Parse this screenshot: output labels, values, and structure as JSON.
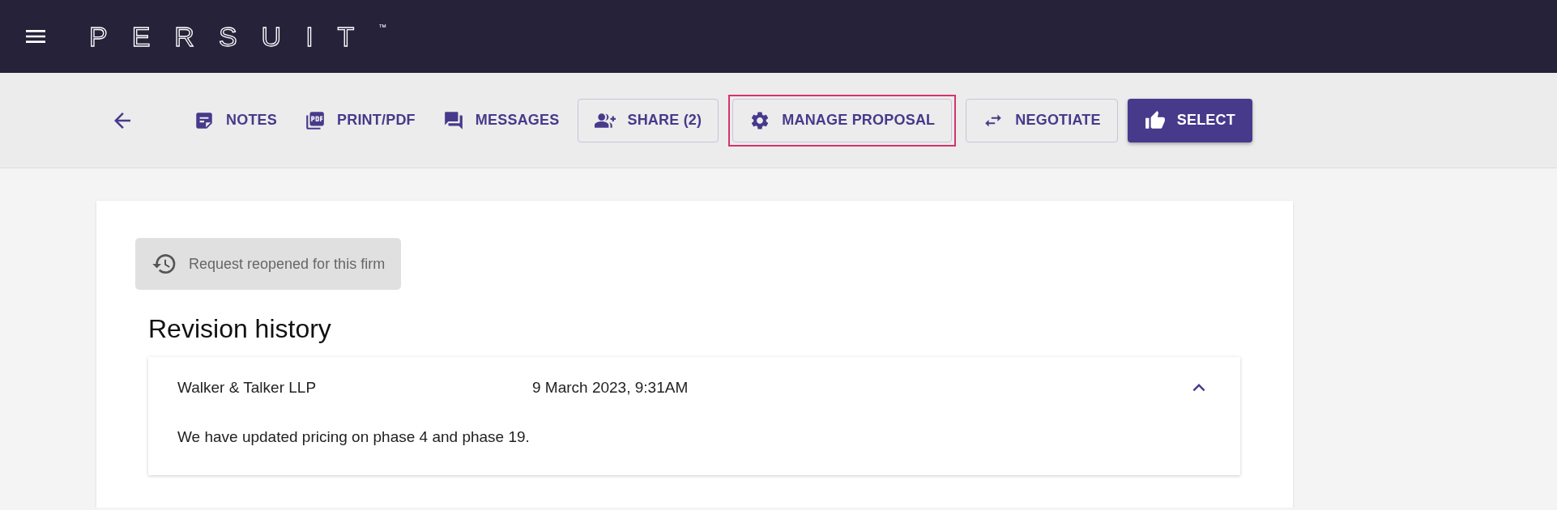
{
  "header": {
    "logo": "PERSUIT",
    "trademark": "™"
  },
  "toolbar": [
    {
      "kind": "text",
      "label": "NOTES",
      "highlighted": false
    },
    {
      "kind": "text",
      "label": "PRINT/PDF",
      "highlighted": false
    },
    {
      "kind": "text",
      "label": "MESSAGES",
      "highlighted": false
    },
    {
      "kind": "outlined",
      "label": "SHARE (2)",
      "highlighted": false
    },
    {
      "kind": "outlined",
      "label": "MANAGE PROPOSAL",
      "highlighted": true
    },
    {
      "kind": "outlined",
      "label": "NEGOTIATE",
      "highlighted": false
    },
    {
      "kind": "primary",
      "label": "SELECT",
      "highlighted": false
    }
  ],
  "notice": "Request reopened for this firm",
  "revision_history": {
    "title": "Revision history",
    "entries": [
      {
        "firm": "Walker & Talker LLP",
        "date": "9 March 2023, 9:31AM",
        "expanded": true,
        "message": "We have updated pricing on phase 4 and phase 19."
      }
    ]
  }
}
